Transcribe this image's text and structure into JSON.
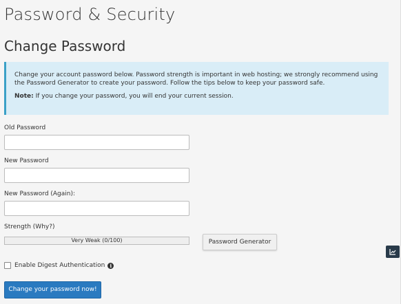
{
  "page": {
    "title": "Password & Security"
  },
  "change_password": {
    "section_title": "Change Password",
    "info_text": "Change your account password below. Password strength is important in web hosting; we strongly recommend using the Password Generator to create your password. Follow the tips below to keep your password safe.",
    "note_label": "Note:",
    "note_text": " If you change your password, you will end your current session.",
    "old_password_label": "Old Password",
    "old_password_value": "",
    "new_password_label": "New Password",
    "new_password_value": "",
    "new_password_again_label": "New Password (Again):",
    "new_password_again_value": "",
    "strength_label": "Strength (Why?)",
    "strength_text": "Very Weak (0/100)",
    "strength_value": 0,
    "password_generator_label": "Password Generator",
    "digest_auth_label": "Enable Digest Authentication",
    "digest_auth_checked": false,
    "submit_label": "Change your password now!"
  },
  "colors": {
    "info_box_bg": "#d9edf7",
    "primary_button": "#2a7ac0",
    "side_widget": "#293a4a"
  },
  "icons": {
    "info_icon": "info-circle-icon",
    "side_widget_icon": "chart-icon"
  }
}
